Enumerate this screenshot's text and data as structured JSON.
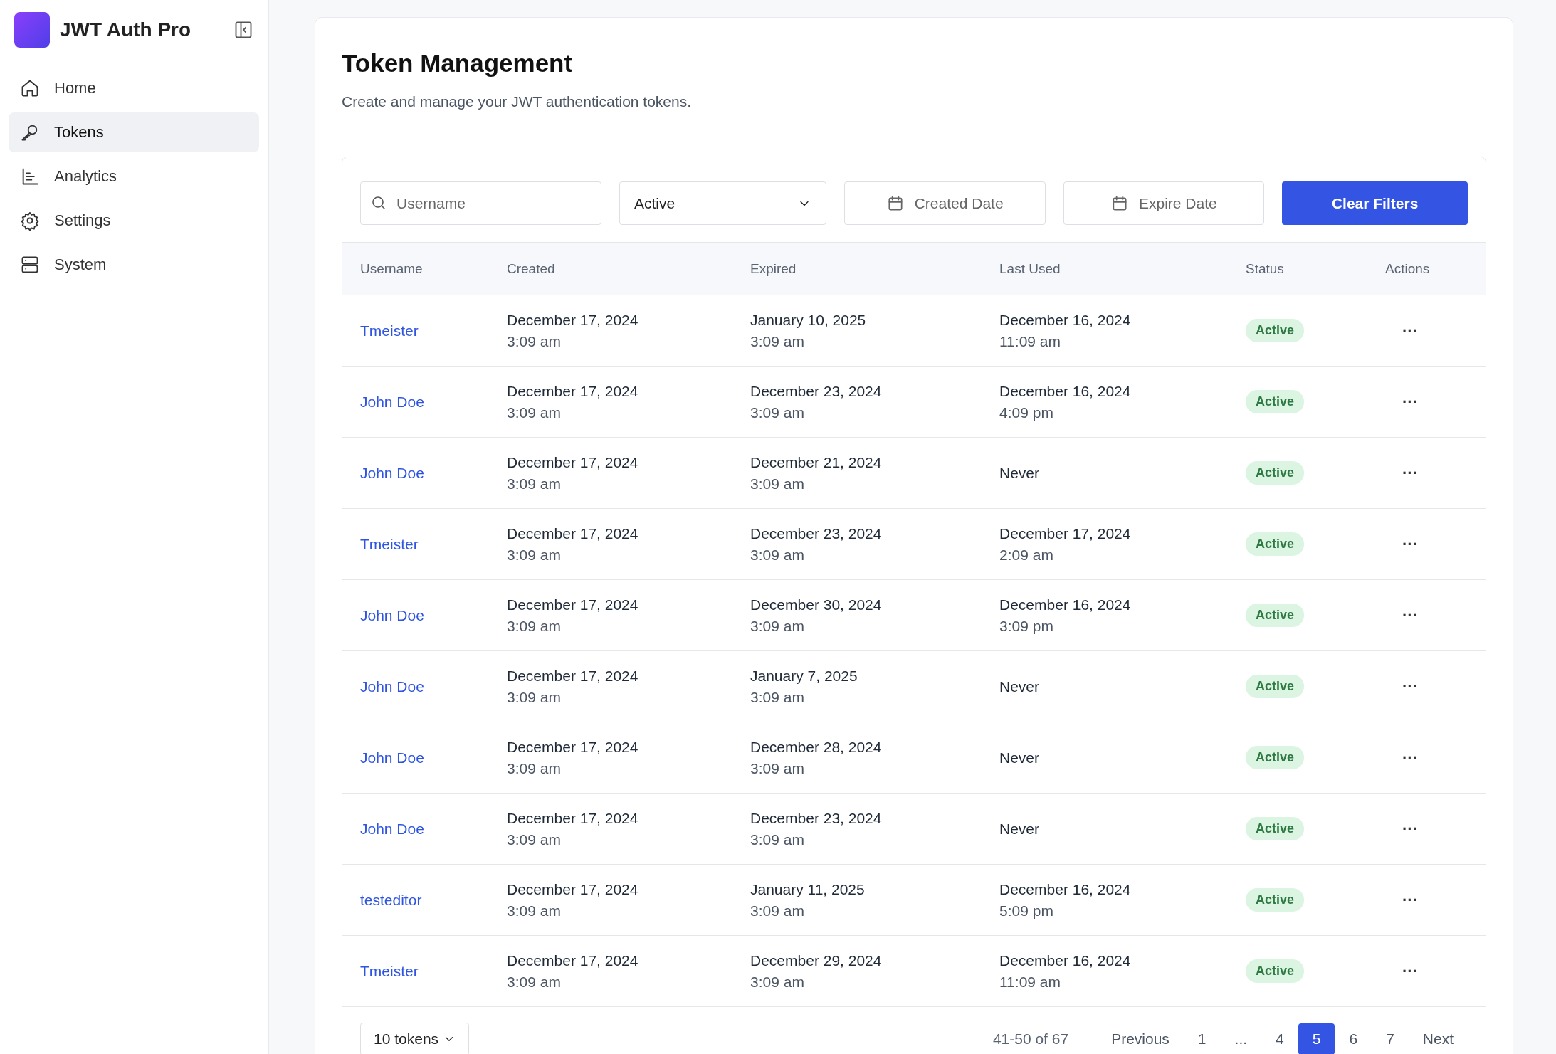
{
  "sidebar": {
    "brand": "JWT Auth Pro",
    "items": [
      {
        "label": "Home",
        "kind": "home",
        "selected": false
      },
      {
        "label": "Tokens",
        "kind": "key",
        "selected": true
      },
      {
        "label": "Analytics",
        "kind": "chart",
        "selected": false
      },
      {
        "label": "Settings",
        "kind": "gear",
        "selected": false
      },
      {
        "label": "System",
        "kind": "server",
        "selected": false
      }
    ]
  },
  "page": {
    "title": "Token Management",
    "subtitle": "Create and manage your JWT authentication tokens."
  },
  "filters": {
    "search": {
      "placeholder": "Username"
    },
    "status_select": {
      "value": "Active"
    },
    "created_date": {
      "placeholder": "Created Date"
    },
    "expire_date": {
      "placeholder": "Expire Date"
    },
    "clear_button": "Clear Filters"
  },
  "table": {
    "columns": [
      "Username",
      "Created",
      "Expired",
      "Last Used",
      "Status",
      "Actions"
    ],
    "rows": [
      {
        "username": "Tmeister",
        "created": [
          "December 17, 2024",
          "3:09 am"
        ],
        "expired": [
          "January 10, 2025",
          "3:09 am"
        ],
        "last_used": [
          "December 16, 2024",
          "11:09 am"
        ],
        "status": "Active",
        "actions": "···"
      },
      {
        "username": "John Doe",
        "created": [
          "December 17, 2024",
          "3:09 am"
        ],
        "expired": [
          "December 23, 2024",
          "3:09 am"
        ],
        "last_used": [
          "December 16, 2024",
          "4:09 pm"
        ],
        "status": "Active",
        "actions": "···"
      },
      {
        "username": "John Doe",
        "created": [
          "December 17, 2024",
          "3:09 am"
        ],
        "expired": [
          "December 21, 2024",
          "3:09 am"
        ],
        "last_used": [
          "Never"
        ],
        "status": "Active",
        "actions": "···"
      },
      {
        "username": "Tmeister",
        "created": [
          "December 17, 2024",
          "3:09 am"
        ],
        "expired": [
          "December 23, 2024",
          "3:09 am"
        ],
        "last_used": [
          "December 17, 2024",
          "2:09 am"
        ],
        "status": "Active",
        "actions": "···"
      },
      {
        "username": "John Doe",
        "created": [
          "December 17, 2024",
          "3:09 am"
        ],
        "expired": [
          "December 30, 2024",
          "3:09 am"
        ],
        "last_used": [
          "December 16, 2024",
          "3:09 pm"
        ],
        "status": "Active",
        "actions": "···"
      },
      {
        "username": "John Doe",
        "created": [
          "December 17, 2024",
          "3:09 am"
        ],
        "expired": [
          "January 7, 2025",
          "3:09 am"
        ],
        "last_used": [
          "Never"
        ],
        "status": "Active",
        "actions": "···"
      },
      {
        "username": "John Doe",
        "created": [
          "December 17, 2024",
          "3:09 am"
        ],
        "expired": [
          "December 28, 2024",
          "3:09 am"
        ],
        "last_used": [
          "Never"
        ],
        "status": "Active",
        "actions": "···"
      },
      {
        "username": "John Doe",
        "created": [
          "December 17, 2024",
          "3:09 am"
        ],
        "expired": [
          "December 23, 2024",
          "3:09 am"
        ],
        "last_used": [
          "Never"
        ],
        "status": "Active",
        "actions": "···"
      },
      {
        "username": "testeditor",
        "created": [
          "December 17, 2024",
          "3:09 am"
        ],
        "expired": [
          "January 11, 2025",
          "3:09 am"
        ],
        "last_used": [
          "December 16, 2024",
          "5:09 pm"
        ],
        "status": "Active",
        "actions": "···"
      },
      {
        "username": "Tmeister",
        "created": [
          "December 17, 2024",
          "3:09 am"
        ],
        "expired": [
          "December 29, 2024",
          "3:09 am"
        ],
        "last_used": [
          "December 16, 2024",
          "11:09 am"
        ],
        "status": "Active",
        "actions": "···"
      }
    ]
  },
  "pagination": {
    "page_size": "10 tokens",
    "range": "41-50 of 67",
    "previous": "Previous",
    "next": "Next",
    "pages": [
      {
        "label": "1",
        "selected": false
      },
      {
        "label": "...",
        "selected": false
      },
      {
        "label": "4",
        "selected": false
      },
      {
        "label": "5",
        "selected": true
      },
      {
        "label": "6",
        "selected": false
      },
      {
        "label": "7",
        "selected": false
      }
    ]
  }
}
